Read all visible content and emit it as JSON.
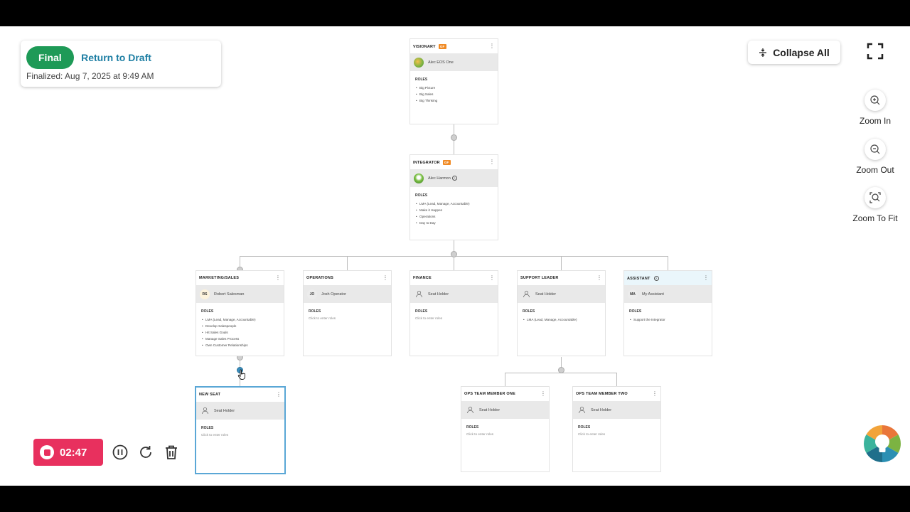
{
  "status": {
    "state_label": "Final",
    "return_label": "Return to Draft",
    "finalized_text": "Finalized: Aug 7, 2025 at 9:49 AM"
  },
  "controls": {
    "collapse_label": "Collapse All",
    "zoom_in_label": "Zoom In",
    "zoom_out_label": "Zoom Out",
    "zoom_fit_label": "Zoom To Fit"
  },
  "recorder": {
    "timer": "02:47",
    "accent": "#e8305e"
  },
  "roles_heading": "ROLES",
  "empty_roles": "Click to enter roles",
  "cards": {
    "visionary": {
      "title": "VISIONARY",
      "badge": "GF",
      "person": "Alec EOS One",
      "roles": [
        "Big Picture",
        "Big Sales",
        "Big Thinking"
      ]
    },
    "integrator": {
      "title": "INTEGRATOR",
      "badge": "GF",
      "person": "Alec Harmon",
      "roles": [
        "LMA (Lead, Manage, Accountable)",
        "Make it Happen",
        "Operations",
        "Day to Day"
      ]
    },
    "marketing": {
      "title": "MARKETING/SALES",
      "initials": "RS",
      "person": "Robert Salesman",
      "roles": [
        "LMA (Lead, Manage, Accountable)",
        "Develop Salespeople",
        "Hit Sales Goals",
        "Manage Sales Process",
        "Own Customer Relationships"
      ]
    },
    "operations": {
      "title": "OPERATIONS",
      "initials": "JO",
      "person": "Josh Operator"
    },
    "finance": {
      "title": "FINANCE",
      "person": "Seat Holder"
    },
    "support": {
      "title": "SUPPORT LEADER",
      "person": "Seat Holder",
      "roles": [
        "LMA (Lead, Manage, Accountable)"
      ]
    },
    "assistant": {
      "title": "ASSISTANT",
      "initials": "MA",
      "person": "My Assistant",
      "roles": [
        "Support the Integrator"
      ]
    },
    "new_seat": {
      "title": "NEW SEAT",
      "person": "Seat Holder"
    },
    "ops_one": {
      "title": "OPS TEAM MEMBER ONE",
      "person": "Seat Holder"
    },
    "ops_two": {
      "title": "OPS TEAM MEMBER TWO",
      "person": "Seat Holder"
    }
  },
  "icons": {
    "fullscreen": "fullscreen-icon",
    "zoom_in": "zoom-in-icon",
    "zoom_out": "zoom-out-icon",
    "zoom_fit": "zoom-fit-icon",
    "collapse": "collapse-icon",
    "stop": "stop-icon",
    "pause": "pause-icon",
    "restart": "restart-icon",
    "trash": "trash-icon",
    "brand": "brand-logo-icon"
  },
  "colors": {
    "final_green": "#1e9a57",
    "link_blue": "#1d7ea3",
    "badge_orange": "#f08a24",
    "selected_border": "#5aa7d6"
  }
}
